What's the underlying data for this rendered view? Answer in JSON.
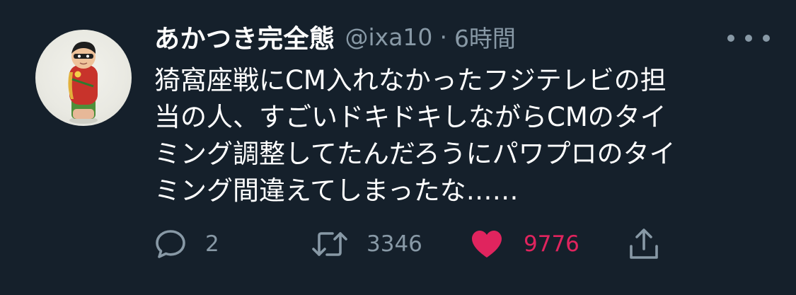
{
  "tweet": {
    "display_name": "あかつき完全態",
    "handle": "@ixa10",
    "separator": "·",
    "time": "6時間",
    "text_lines": [
      "猗窩座戦にCM入れなかったフジテレビの担",
      "当の人、すごいドキドキしながらCMのタイ",
      "ミング調整してたんだろうにパワプロのタイ",
      "ミング間違えてしまったな……"
    ],
    "replies": "2",
    "retweets": "3346",
    "likes": "9776"
  },
  "icons": {
    "more": "more-horizontal-icon",
    "reply": "speech-bubble-icon",
    "retweet": "retweet-arrows-icon",
    "like": "heart-filled-icon",
    "share": "share-upload-icon"
  },
  "colors": {
    "background": "#15202b",
    "text_primary": "#ffffff",
    "text_secondary": "#8899a6",
    "like_active": "#e0245e"
  }
}
